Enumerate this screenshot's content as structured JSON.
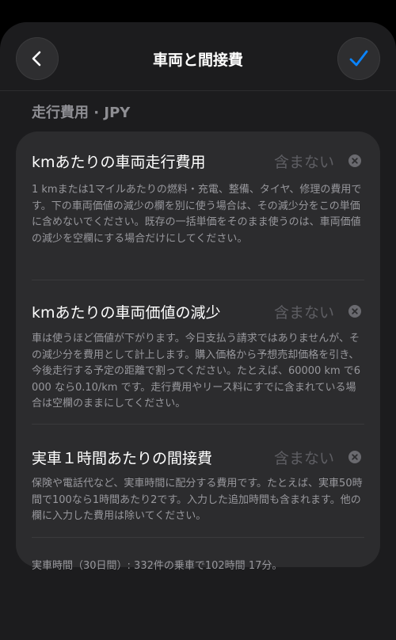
{
  "header": {
    "title": "車両と間接費",
    "back_icon": "chevron-left-icon",
    "confirm_icon": "checkmark-icon",
    "accent_color": "#0a84ff"
  },
  "section": {
    "label": "走行費用 · JPY"
  },
  "rows": [
    {
      "title": "kmあたりの車両走行費用",
      "value_placeholder": "含まない",
      "description": "1 kmまたは1マイルあたりの燃料・充電、整備、タイヤ、修理の費用です。下の車両価値の減少の欄を別に使う場合は、その減少分をこの単価に含めないでください。既存の一括単価をそのまま使うのは、車両価値の減少を空欄にする場合だけにしてください。"
    },
    {
      "title": "kmあたりの車両価値の減少",
      "value_placeholder": "含まない",
      "description": "車は使うほど価値が下がります。今日支払う請求ではありませんが、その減少分を費用として計上します。購入価格から予想売却価格を引き、今後走行する予定の距離で割ってください。たとえば、60000 km で6000 なら0.10/km です。走行費用やリース料にすでに含まれている場合は空欄のままにしてください。"
    },
    {
      "title": "実車１時間あたりの間接費",
      "value_placeholder": "含まない",
      "description": "保険や電話代など、実車時間に配分する費用です。たとえば、実車50時間で100なら1時間あたり2です。入力した追加時間も含まれます。他の欄に入力した費用は除いてください。"
    }
  ],
  "footer": {
    "summary": "実車時間（30日間）: 332件の乗車で102時間 17分。"
  }
}
